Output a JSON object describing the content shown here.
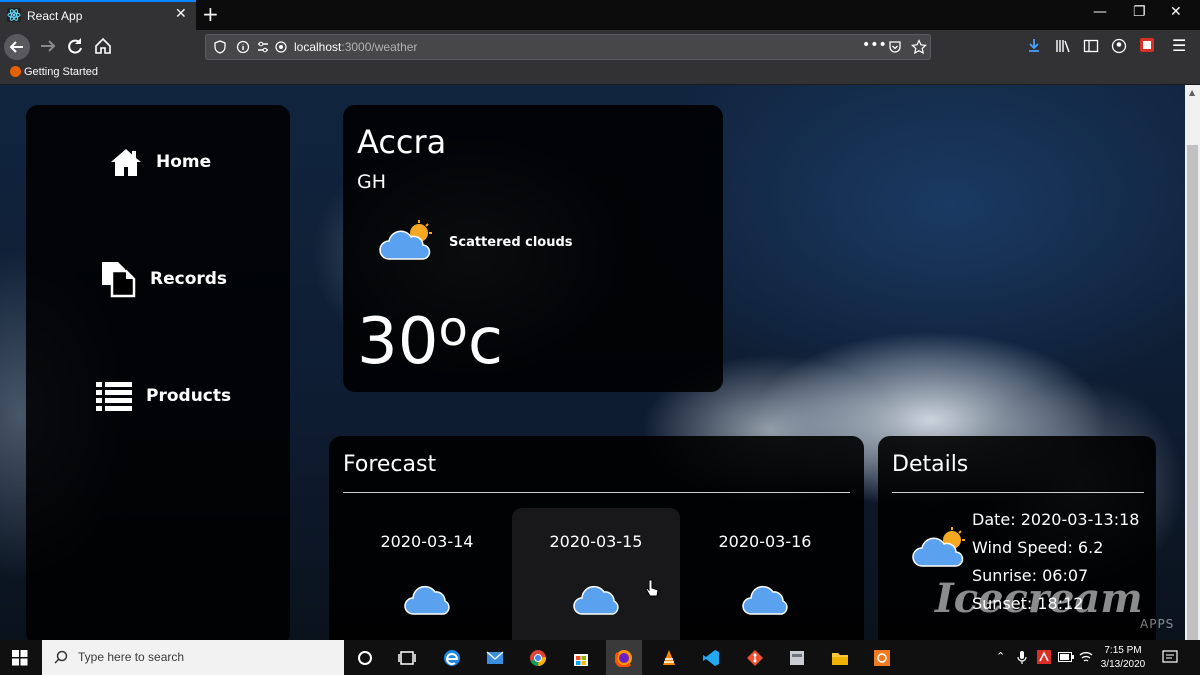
{
  "browser": {
    "tab_title": "React App",
    "url_host": "localhost",
    "url_rest": ":3000/weather",
    "bookmark": "Getting Started"
  },
  "sidebar": {
    "items": [
      {
        "label": "Home",
        "icon": "home-icon"
      },
      {
        "label": "Records",
        "icon": "records-icon"
      },
      {
        "label": "Products",
        "icon": "list-icon"
      }
    ]
  },
  "current": {
    "city": "Accra",
    "country": "GH",
    "condition": "Scattered clouds",
    "temperature": "30",
    "unit_o": "o",
    "unit_c": "c"
  },
  "forecast": {
    "title": "Forecast",
    "days": [
      {
        "date": "2020-03-14"
      },
      {
        "date": "2020-03-15"
      },
      {
        "date": "2020-03-16"
      }
    ]
  },
  "details": {
    "title": "Details",
    "date": "Date: 2020-03-13:18",
    "wind": "Wind Speed: 6.2",
    "sunrise": "Sunrise: 06:07",
    "sunset": "Sunset: 18:12"
  },
  "watermark": {
    "main": "Icecream",
    "sub": "APPS"
  },
  "taskbar": {
    "search_placeholder": "Type here to search",
    "time": "7:15 PM",
    "date": "3/13/2020"
  },
  "colors": {
    "accent": "#0a84ff",
    "cloud": "#5aa2ef",
    "sun": "#f7a823"
  }
}
